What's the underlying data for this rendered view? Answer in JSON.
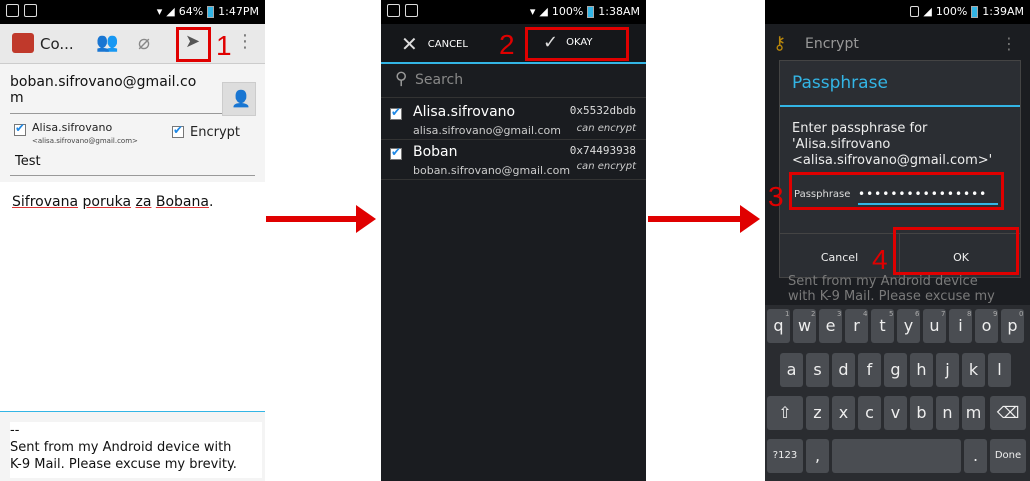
{
  "phone1": {
    "status": {
      "battery": "64%",
      "time": "1:47PM"
    },
    "actionbar": {
      "title": "Co..."
    },
    "to_address_line1": "boban.sifrovano@gmail.co",
    "to_address_line2": "m",
    "chip_name": "Alisa.sifrovano",
    "chip_email": "<alisa.sifrovano@gmail.com>",
    "encrypt_label": "Encrypt",
    "subject": "Test",
    "body_words": [
      "Sifrovana",
      "poruka",
      "za",
      "Bobana",
      "."
    ],
    "signature_sep": "--",
    "signature_line1": "Sent from my Android device with",
    "signature_line2": "K-9 Mail. Please excuse my brevity."
  },
  "phone2": {
    "status": {
      "battery": "100%",
      "time": "1:38AM"
    },
    "cancel_label": "CANCEL",
    "okay_label": "OKAY",
    "search_placeholder": "Search",
    "contacts": [
      {
        "name": "Alisa.sifrovano",
        "email": "alisa.sifrovano@gmail.com",
        "key": "0x5532dbdb",
        "status": "can encrypt"
      },
      {
        "name": "Boban",
        "email": "boban.sifrovano@gmail.com",
        "key": "0x74493938",
        "status": "can encrypt"
      }
    ]
  },
  "phone3": {
    "status": {
      "battery": "100%",
      "time": "1:39AM"
    },
    "bg_title": "Encrypt",
    "dialog_title": "Passphrase",
    "dialog_msg1": "Enter passphrase for",
    "dialog_msg2": "'Alisa.sifrovano",
    "dialog_msg3": "<alisa.sifrovano@gmail.com>'",
    "pass_label": "Passphrase",
    "pass_value": "••••••••••••••••",
    "cancel_label": "Cancel",
    "ok_label": "OK",
    "bg_text1": "Sent from my Android device",
    "bg_text2": "with K-9 Mail. Please excuse my",
    "kb_row1": [
      "q",
      "w",
      "e",
      "r",
      "t",
      "y",
      "u",
      "i",
      "o",
      "p"
    ],
    "kb_row1_nums": [
      "1",
      "2",
      "3",
      "4",
      "5",
      "6",
      "7",
      "8",
      "9",
      "0"
    ],
    "kb_row2": [
      "a",
      "s",
      "d",
      "f",
      "g",
      "h",
      "j",
      "k",
      "l"
    ],
    "kb_row3": [
      "z",
      "x",
      "c",
      "v",
      "b",
      "n",
      "m"
    ],
    "kb_sym": "?123",
    "kb_comma": ",",
    "kb_dot": ".",
    "kb_done": "Done"
  },
  "steps": [
    "1",
    "2",
    "3",
    "4"
  ],
  "colors": {
    "highlight": "#e00000",
    "accent": "#33b5e5"
  }
}
